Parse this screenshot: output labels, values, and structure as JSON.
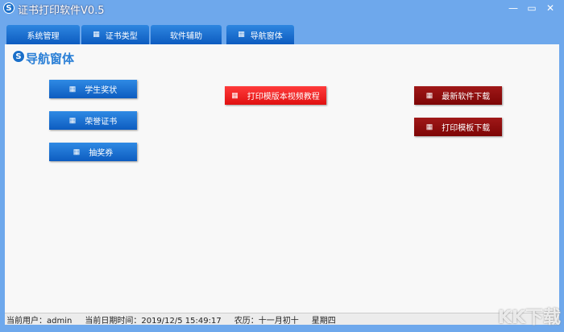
{
  "window": {
    "title": "证书打印软件V0.5",
    "controls": {
      "minimize": "—",
      "maximize": "▭",
      "close": "✕"
    }
  },
  "tabs": [
    {
      "label": "系统管理",
      "icon": false
    },
    {
      "label": "证书类型",
      "icon": true
    },
    {
      "label": "软件辅助",
      "icon": false
    },
    {
      "label": "导航窗体",
      "icon": true
    }
  ],
  "page": {
    "title": "导航窗体"
  },
  "buttons": {
    "student_award": "学生奖状",
    "honor_cert": "荣誉证书",
    "lottery": "抽奖券",
    "video_tutorial": "打印模版本视频教程",
    "latest_download": "最新软件下载",
    "template_download": "打印模板下载"
  },
  "colors": {
    "blue": "#1a6fd0",
    "red": "#f02020",
    "dark_red": "#8b0a0a"
  },
  "status": {
    "user": "当前用户：admin",
    "datetime": "当前日期时间：2019/12/5 15:49:17",
    "lunar": "农历：十一月初十",
    "weekday": "星期四"
  },
  "watermark": "KK下载"
}
